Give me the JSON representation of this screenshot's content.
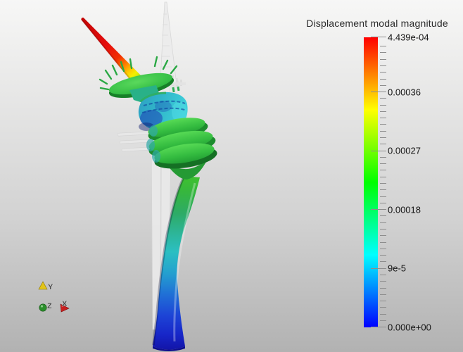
{
  "view": {
    "background_top": "#f7f7f6",
    "background_bottom": "#b2b2b2"
  },
  "colorbar": {
    "title": "Displacement modal magnitude",
    "min": 0,
    "max": 0.0004439,
    "minor_tick_step": 1e-05,
    "labels": [
      {
        "text": "4.439e-04",
        "value": 0.0004439
      },
      {
        "text": "0.00036",
        "value": 0.00036
      },
      {
        "text": "0.00027",
        "value": 0.00027
      },
      {
        "text": "0.00018",
        "value": 0.00018
      },
      {
        "text": "9e-5",
        "value": 9e-05
      },
      {
        "text": "0.000e+00",
        "value": 0
      }
    ],
    "gradient_top_to_bottom": [
      "#ff0000",
      "#ff8000",
      "#ffff00",
      "#80ff00",
      "#00ff00",
      "#00ff80",
      "#00ffff",
      "#0080ff",
      "#0000ff"
    ]
  },
  "orientation_axes": {
    "x_label": "X",
    "y_label": "Y",
    "z_label": "Z",
    "x_color": "#c92020",
    "y_color": "#e2c419",
    "z_color": "#2c8f2c"
  },
  "chart_data": {
    "type": "heatmap",
    "title": "Displacement modal magnitude",
    "colormap": {
      "orientation": "vertical",
      "position": "right",
      "min": 0.0,
      "max": 0.0004439,
      "min_label": "0.000e+00",
      "max_label": "4.439e-04",
      "tick_values": [
        0,
        9e-05,
        0.00018,
        0.00027,
        0.00036,
        0.0004439
      ],
      "tick_labels": [
        "0.000e+00",
        "9e-5",
        "0.00018",
        "0.00027",
        "0.00036",
        "4.439e-04"
      ],
      "colors_low_to_high": [
        "#0000ff",
        "#00ffff",
        "#00ff00",
        "#ffff00",
        "#ff8000",
        "#ff0000"
      ],
      "minor_tick_step": 1e-05
    },
    "scene_summary": {
      "max_displacement_location": "antenna tip (red)",
      "min_displacement_location": "tower base (blue)",
      "reference_geometry": "undeformed tower shown translucent gray"
    }
  }
}
